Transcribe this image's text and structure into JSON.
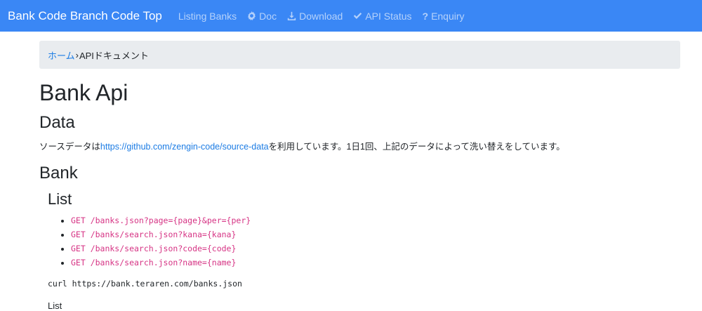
{
  "navbar": {
    "brand": "Bank Code Branch Code Top",
    "items": [
      {
        "label": "Listing Banks",
        "icon": ""
      },
      {
        "label": "Doc",
        "icon": "gear-icon"
      },
      {
        "label": "Download",
        "icon": "download-icon"
      },
      {
        "label": "API Status",
        "icon": "check-icon"
      },
      {
        "label": "Enquiry",
        "icon": "question-icon"
      }
    ],
    "colors": {
      "background": "#3a87f5",
      "link": "#1c7ce4",
      "code": "#d63384"
    }
  },
  "breadcrumb": {
    "home": "ホーム",
    "separator": "›",
    "current": "APIドキュメント"
  },
  "main": {
    "title": "Bank Api",
    "data_heading": "Data",
    "source_prefix": "ソースデータは",
    "source_link": "https://github.com/zengin-code/source-data",
    "source_suffix": "を利用しています。1日1回、上記のデータによって洗い替えをしています。",
    "bank_heading": "Bank",
    "list_heading": "List",
    "endpoints": [
      "GET /banks.json?page={page}&per={per}",
      "GET /banks/search.json?kana={kana}",
      "GET /banks/search.json?code={code}",
      "GET /banks/search.json?name={name}"
    ],
    "curl_example": "curl https://bank.teraren.com/banks.json",
    "next_text": "List"
  }
}
